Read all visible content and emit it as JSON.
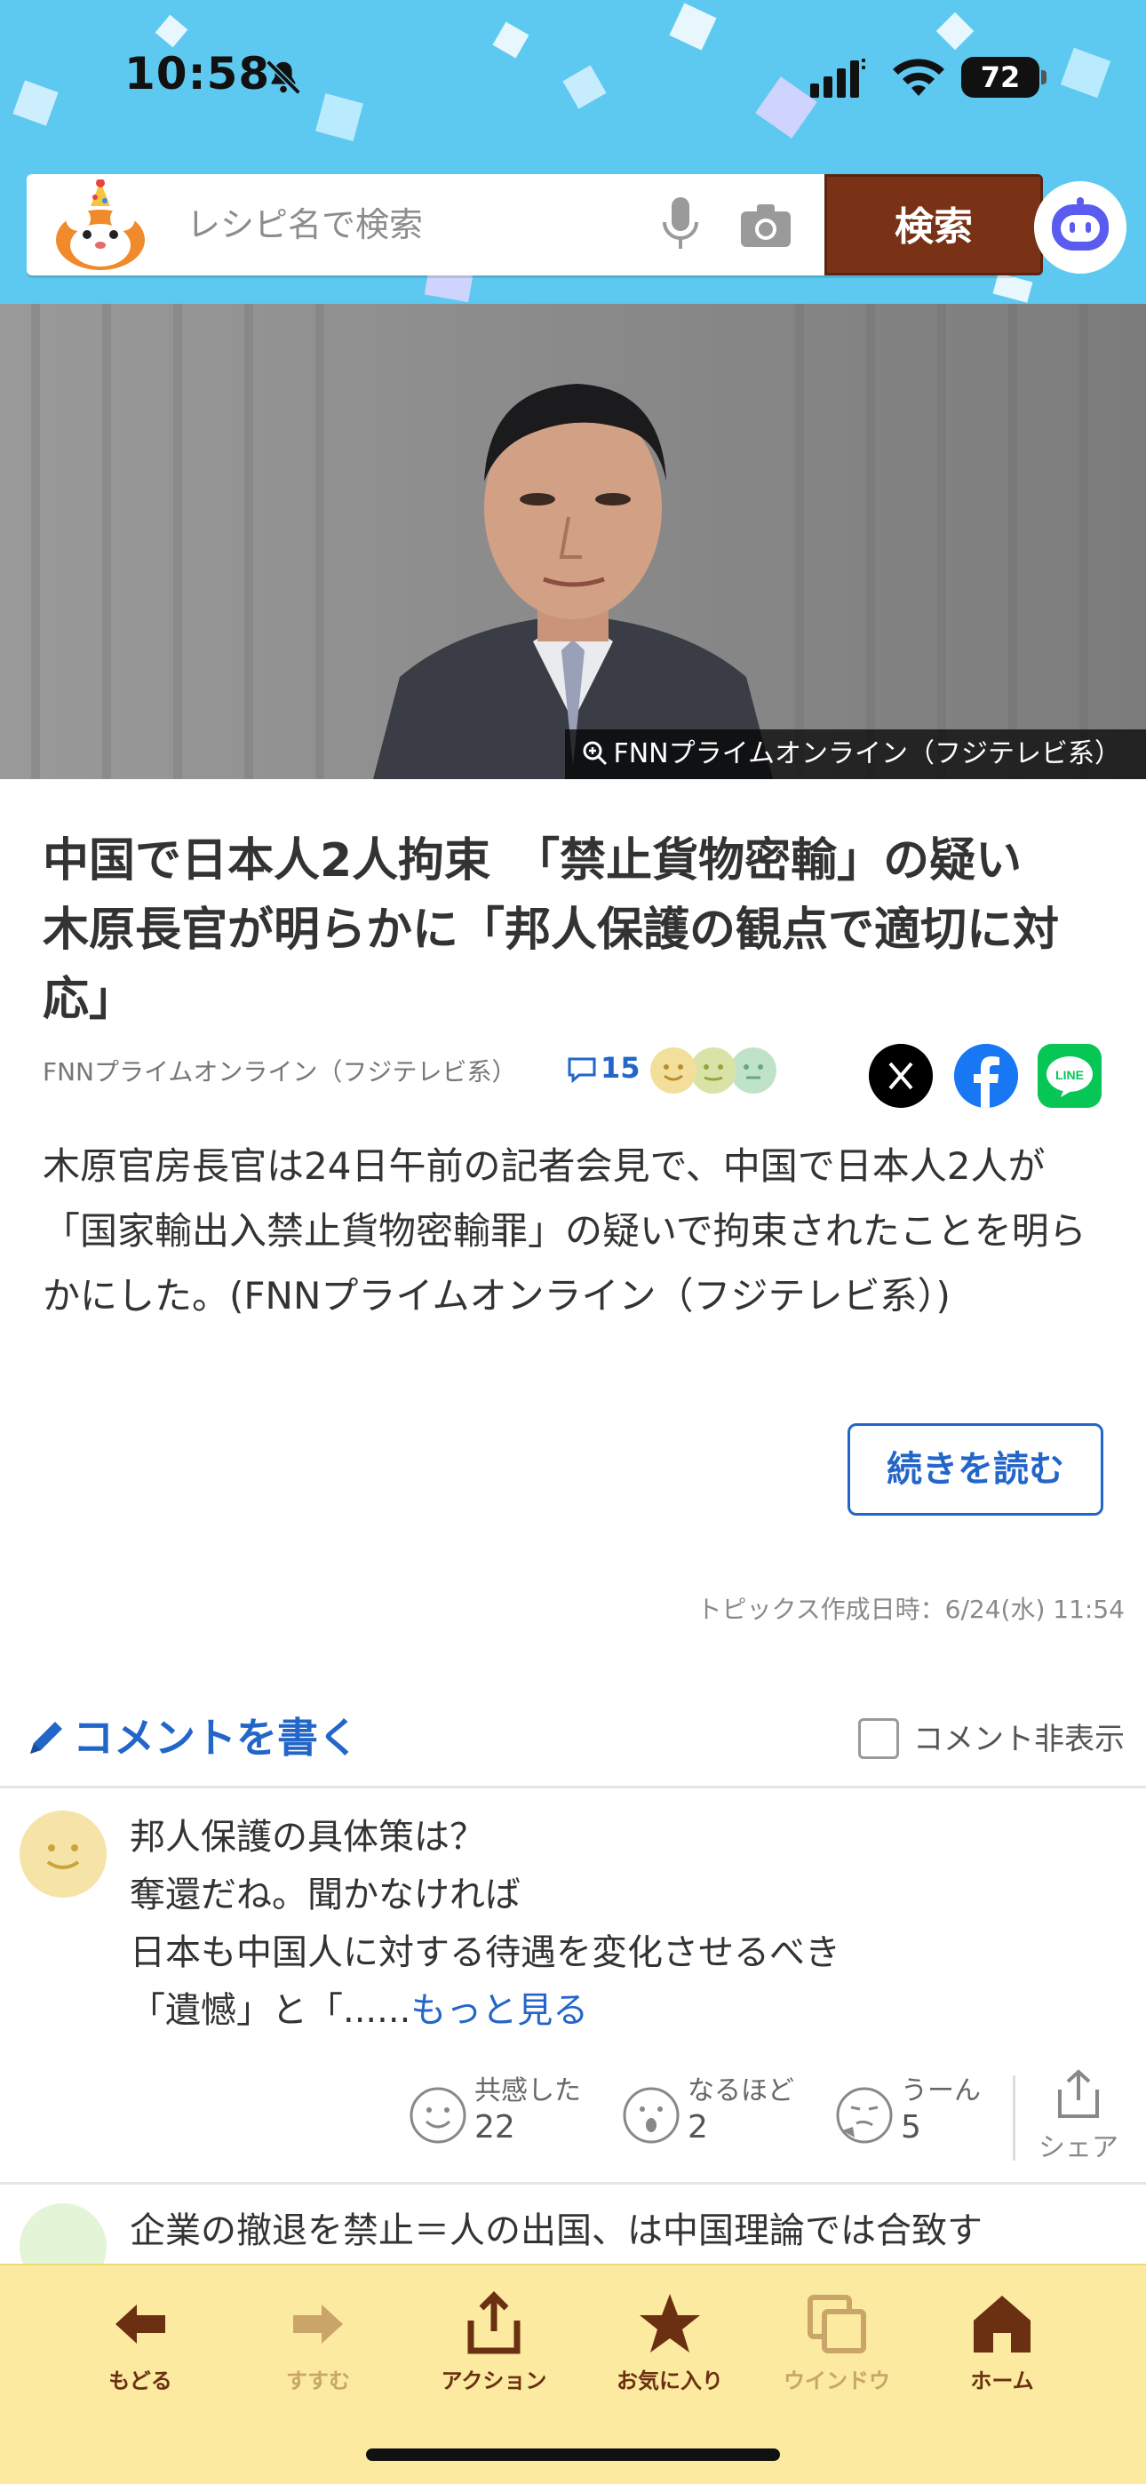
{
  "status_bar": {
    "time": "10:58",
    "battery": "72"
  },
  "search": {
    "placeholder": "レシピ名で検索",
    "button_label": "検索"
  },
  "hero": {
    "credit": "FNNプライムオンライン（フジテレビ系）"
  },
  "article": {
    "headline": "中国で日本人2人拘束　「禁止貨物密輸」の疑い　木原長官が明らかに「邦人保護の観点で適切に対応」",
    "source": "FNNプライムオンライン（フジテレビ系）",
    "comment_count": "15",
    "summary": "木原官房長官は24日午前の記者会見で、中国で日本人2人が「国家輸出入禁止貨物密輸罪」の疑いで拘束されたことを明らかにした。(FNNプライムオンライン（フジテレビ系）)",
    "read_more_label": "続きを読む",
    "topic_date": "トピックス作成日時：6/24(水) 11:54"
  },
  "comments_section": {
    "write_label": "コメントを書く",
    "hide_label": "コメント非表示",
    "comments": [
      {
        "lines": [
          "邦人保護の具体策は？",
          "奪還だね。聞かなければ",
          "日本も中国人に対する待遇を変化させるべき"
        ],
        "truncated_line": "「遺憾」と「......",
        "more_label": "もっと見る",
        "reactions": [
          {
            "label": "共感した",
            "count": "22"
          },
          {
            "label": "なるほど",
            "count": "2"
          },
          {
            "label": "うーん",
            "count": "5"
          }
        ],
        "share_label": "シェア"
      },
      {
        "lines": [
          "企業の撤退を禁止＝人の出国、は中国理論では合致す"
        ]
      }
    ]
  },
  "toolbar": {
    "items": [
      {
        "label": "もどる",
        "color": "#6b2f12"
      },
      {
        "label": "すすむ",
        "color": "#c9a56a"
      },
      {
        "label": "アクション",
        "color": "#6b2f12"
      },
      {
        "label": "お気に入り",
        "color": "#6b2f12"
      },
      {
        "label": "ウインドウ",
        "color": "#c9a56a"
      },
      {
        "label": "ホーム",
        "color": "#6b2f12"
      }
    ]
  },
  "colors": {
    "header_bg": "#5ec9f0",
    "search_button": "#7a3216",
    "link": "#2366c9",
    "toolbar_bg": "#fbeaa0"
  }
}
